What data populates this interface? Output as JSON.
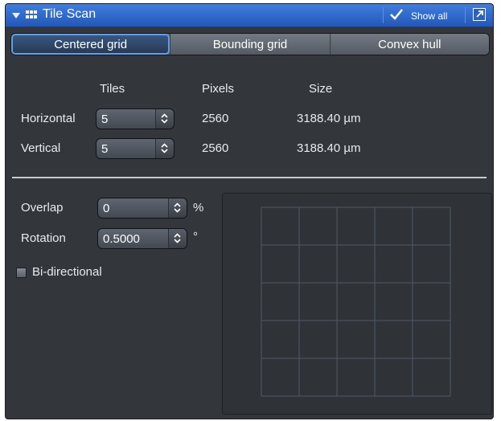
{
  "header": {
    "title": "Tile Scan",
    "show_all_label": "Show all"
  },
  "tabs": [
    {
      "label": "Centered grid",
      "active": true
    },
    {
      "label": "Bounding grid",
      "active": false
    },
    {
      "label": "Convex hull",
      "active": false
    }
  ],
  "grid_table": {
    "headers": {
      "tiles": "Tiles",
      "pixels": "Pixels",
      "size": "Size"
    },
    "rows": [
      {
        "label": "Horizontal",
        "tiles": "5",
        "pixels": "2560",
        "size": "3188.40 µm"
      },
      {
        "label": "Vertical",
        "tiles": "5",
        "pixels": "2560",
        "size": "3188.40 µm"
      }
    ]
  },
  "options": {
    "overlap_label": "Overlap",
    "overlap_value": "0",
    "overlap_unit": "%",
    "rotation_label": "Rotation",
    "rotation_value": "0.5000",
    "rotation_unit": "°",
    "bidirectional_label": "Bi-directional",
    "bidirectional_checked": false
  },
  "preview": {
    "columns": 5,
    "rows": 5,
    "grid_color": "#4c5a68"
  },
  "colors": {
    "title_bar": "#2f6cd0",
    "panel_bg": "#33363b",
    "active_tab_outline": "#5f9fe8"
  }
}
